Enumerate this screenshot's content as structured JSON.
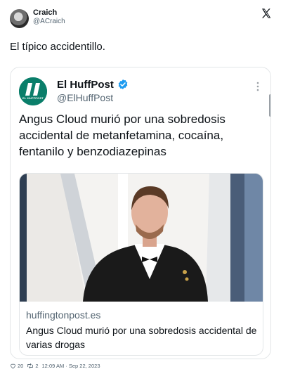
{
  "author": {
    "name": "Craich",
    "handle": "@ACraich"
  },
  "tweet": {
    "text": "El típico accidentillo."
  },
  "quoted": {
    "logo_text": "EL HUFFPOST",
    "name": "El HuffPost",
    "handle": "@ElHuffPost",
    "headline": "Angus Cloud murió por una sobredosis accidental de metanfetamina, cocaína, fentanilo y benzodiazepinas",
    "link": {
      "domain": "huffingtonpost.es",
      "title": "Angus Cloud murió por una sobredosis accidental de varias drogas"
    }
  },
  "meta": {
    "likes": "20",
    "retweets": "2",
    "timestamp": "12:09 AM · Sep 22, 2023"
  },
  "colors": {
    "secondary_text": "#536471",
    "verified": "#1d9bf0",
    "huffpost_green": "#0a7e6a"
  },
  "icons": [
    "x-logo-icon",
    "verified-badge-icon",
    "more-icon",
    "heart-icon",
    "retweet-icon"
  ]
}
